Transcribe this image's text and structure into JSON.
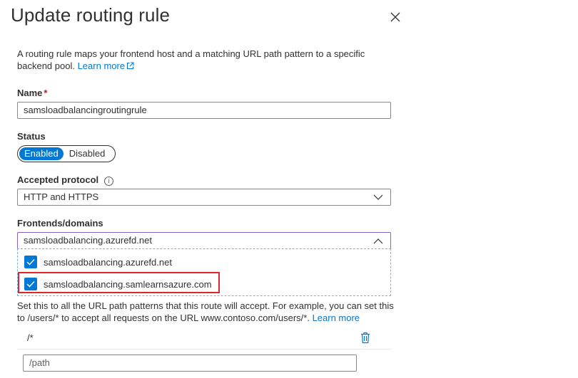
{
  "panel": {
    "title": "Update routing rule",
    "description": "A routing rule maps your frontend host and a matching URL path pattern to a specific backend pool.",
    "learn_more": "Learn more"
  },
  "name_field": {
    "label": "Name",
    "required_marker": "*",
    "value": "samsloadbalancingroutingrule"
  },
  "status": {
    "label": "Status",
    "enabled_label": "Enabled",
    "disabled_label": "Disabled",
    "selected": "Enabled"
  },
  "protocol": {
    "label": "Accepted protocol",
    "value": "HTTP and HTTPS"
  },
  "frontends": {
    "label": "Frontends/domains",
    "value": "samsloadbalancing.azurefd.net",
    "options": [
      {
        "label": "samsloadbalancing.azurefd.net",
        "checked": true
      },
      {
        "label": "samsloadbalancing.samlearnsazure.com",
        "checked": true
      }
    ]
  },
  "patterns": {
    "help_text": "Set this to all the URL path patterns that this route will accept. For example, you can set this to /users/* to accept all requests on the URL www.contoso.com/users/*.",
    "learn_more": "Learn more",
    "items": [
      "/*"
    ],
    "new_placeholder": "/path"
  },
  "colors": {
    "accent": "#0078d4",
    "highlight_border": "#e0262b",
    "required": "#a4262c"
  }
}
